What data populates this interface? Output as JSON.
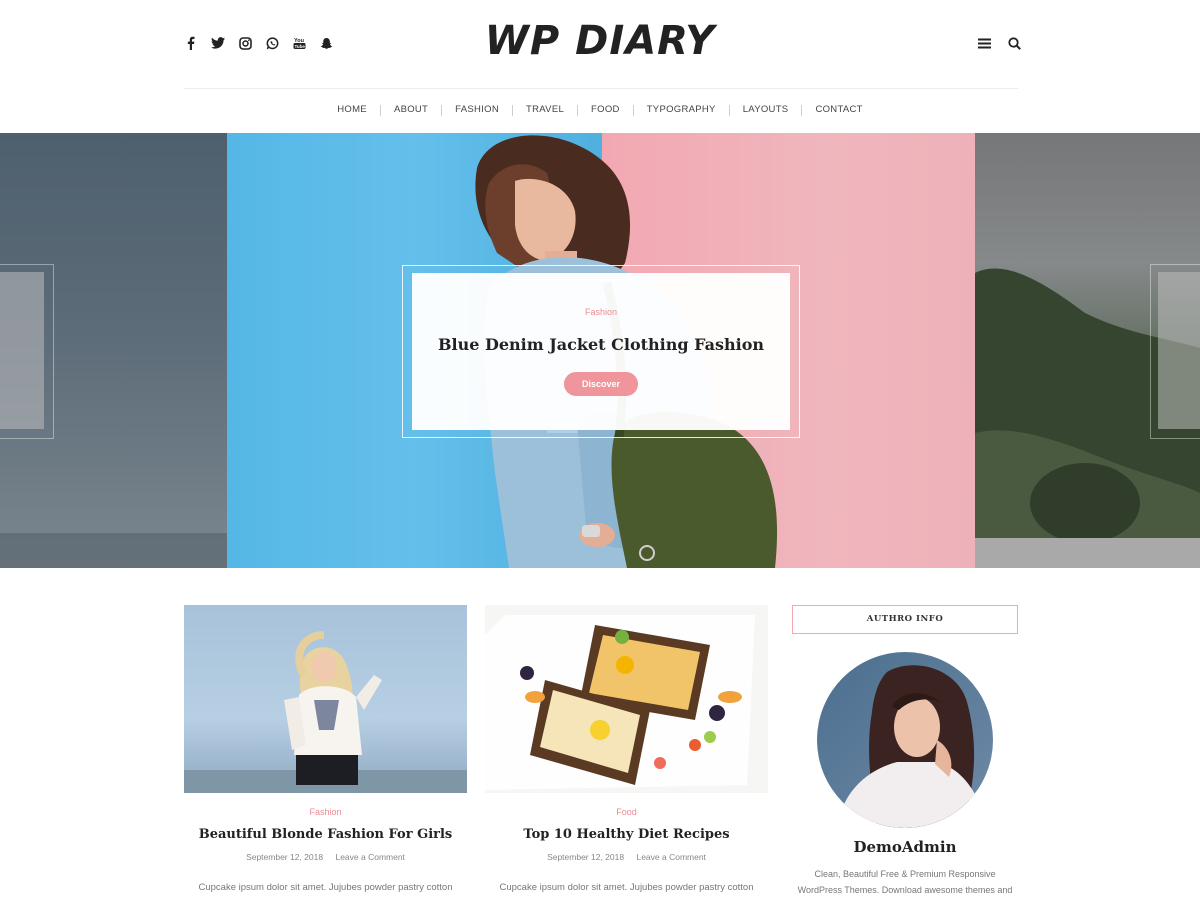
{
  "header": {
    "logo": "WP DIARY",
    "social_icons": [
      "facebook-icon",
      "twitter-icon",
      "instagram-icon",
      "whatsapp-icon",
      "youtube-icon",
      "snapchat-icon"
    ],
    "tool_icons": [
      "menu-icon",
      "search-icon"
    ]
  },
  "nav": {
    "items": [
      "HOME",
      "ABOUT",
      "FASHION",
      "TRAVEL",
      "FOOD",
      "TYPOGRAPHY",
      "LAYOUTS",
      "CONTACT"
    ]
  },
  "slider": {
    "category": "Fashion",
    "title": "Blue Denim Jacket Clothing Fashion",
    "button": "Discover"
  },
  "posts": [
    {
      "category": "Fashion",
      "title": "Beautiful Blonde Fashion For Girls",
      "date": "September 12, 2018",
      "comments": "Leave a Comment",
      "excerpt": "Cupcake ipsum dolor sit amet. Jujubes powder pastry cotton"
    },
    {
      "category": "Food",
      "title": "Top 10 Healthy Diet Recipes",
      "date": "September 12, 2018",
      "comments": "Leave a Comment",
      "excerpt": "Cupcake ipsum dolor sit amet. Jujubes powder pastry cotton"
    }
  ],
  "sidebar": {
    "widget_title": "AUTHRO INFO",
    "author_name": "DemoAdmin",
    "author_desc": "Clean, Beautiful Free & Premium Responsive WordPress Themes. Download awesome themes and"
  },
  "colors": {
    "accent": "#f0959b",
    "category": "#e88d93",
    "text_dark": "#222222"
  }
}
